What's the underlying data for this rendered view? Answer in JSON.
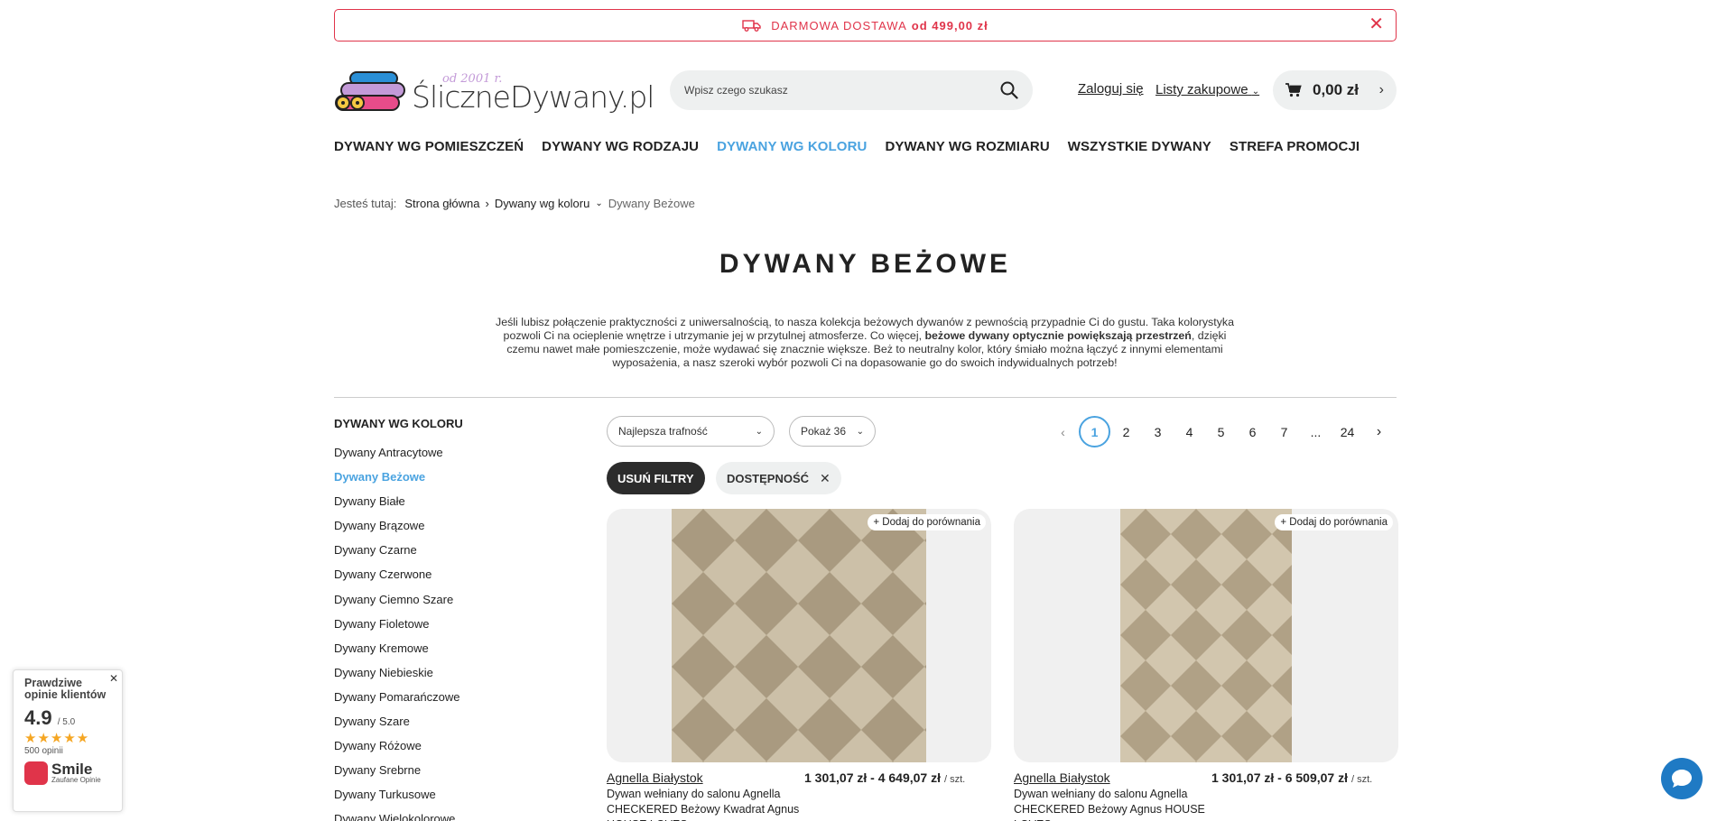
{
  "promo": {
    "text": "DARMOWA DOSTAWA",
    "highlight": "od 499,00 zł",
    "color": "#e0344a"
  },
  "header": {
    "logo_text": "ŚliczneDywany.pl",
    "logo_since": "od 2001 r.",
    "search_placeholder": "Wpisz czego szukasz",
    "login": "Zaloguj się",
    "lists": "Listy zakupowe",
    "cart_amount": "0,00 zł"
  },
  "nav": {
    "items": [
      "DYWANY WG POMIESZCZEŃ",
      "DYWANY WG RODZAJU",
      "DYWANY WG KOLORU",
      "DYWANY WG ROZMIARU",
      "WSZYSTKIE DYWANY",
      "STREFA PROMOCJI"
    ],
    "active_index": 2,
    "active_color": "#4aa3e0"
  },
  "breadcrumb": {
    "label": "Jesteś tutaj:",
    "items": [
      "Strona główna",
      "Dywany wg koloru",
      "Dywany Beżowe"
    ]
  },
  "page": {
    "title": "DYWANY BEŻOWE",
    "desc_1": "Jeśli lubisz połączenie praktyczności z uniwersalnością, to nasza kolekcja beżowych dywanów z pewnością przypadnie Ci do gustu. Taka kolorystyka pozwoli Ci na ocieplenie wnętrze i utrzymanie jej w przytulnej atmosferze. Co więcej, ",
    "desc_bold": "beżowe dywany optycznie powiększają przestrzeń",
    "desc_2": ", dzięki czemu nawet małe pomieszczenie, może wydawać się znacznie większe. Beż to neutralny kolor, który śmiało można łączyć z innymi elementami wyposażenia, a nasz szeroki wybór pozwoli Ci na dopasowanie go do swoich indywidualnych potrzeb!"
  },
  "sidebar": {
    "title": "DYWANY WG KOLORU",
    "items": [
      "Dywany Antracytowe",
      "Dywany Beżowe",
      "Dywany Białe",
      "Dywany Brązowe",
      "Dywany Czarne",
      "Dywany Czerwone",
      "Dywany Ciemno Szare",
      "Dywany Fioletowe",
      "Dywany Kremowe",
      "Dywany Niebieskie",
      "Dywany Pomarańczowe",
      "Dywany Szare",
      "Dywany Różowe",
      "Dywany Srebrne",
      "Dywany Turkusowe",
      "Dywany Wielokolorowe"
    ],
    "active_index": 1
  },
  "toolbar": {
    "sort": "Najlepsza trafność",
    "per_page": "Pokaż 36",
    "pages": [
      "1",
      "2",
      "3",
      "4",
      "5",
      "6",
      "7",
      "...",
      "24"
    ],
    "current_page": "1",
    "clear_filters": "USUŃ FILTRY",
    "filter_chip": "DOSTĘPNOŚĆ"
  },
  "products": [
    {
      "compare": "+ Dodaj do porównania",
      "brand": "Agnella Białystok",
      "price": "1 301,07 zł - 4 649,07 zł",
      "unit": "/ szt.",
      "name": "Dywan wełniany do salonu Agnella CHECKERED Beżowy Kwadrat Agnus HOUSE LOVES"
    },
    {
      "compare": "+ Dodaj do porównania",
      "brand": "Agnella Białystok",
      "price": "1 301,07 zł - 6 509,07 zł",
      "unit": "/ szt.",
      "name": "Dywan wełniany do salonu Agnella CHECKERED Beżowy Agnus HOUSE LOVES"
    }
  ],
  "reviews": {
    "heading": "Prawdziwe opinie klientów",
    "score": "4.9",
    "scale": "/ 5.0",
    "count": "500 opinii",
    "stars": 5,
    "brand": "Smile",
    "brand_sub": "Zaufane Opinie"
  }
}
